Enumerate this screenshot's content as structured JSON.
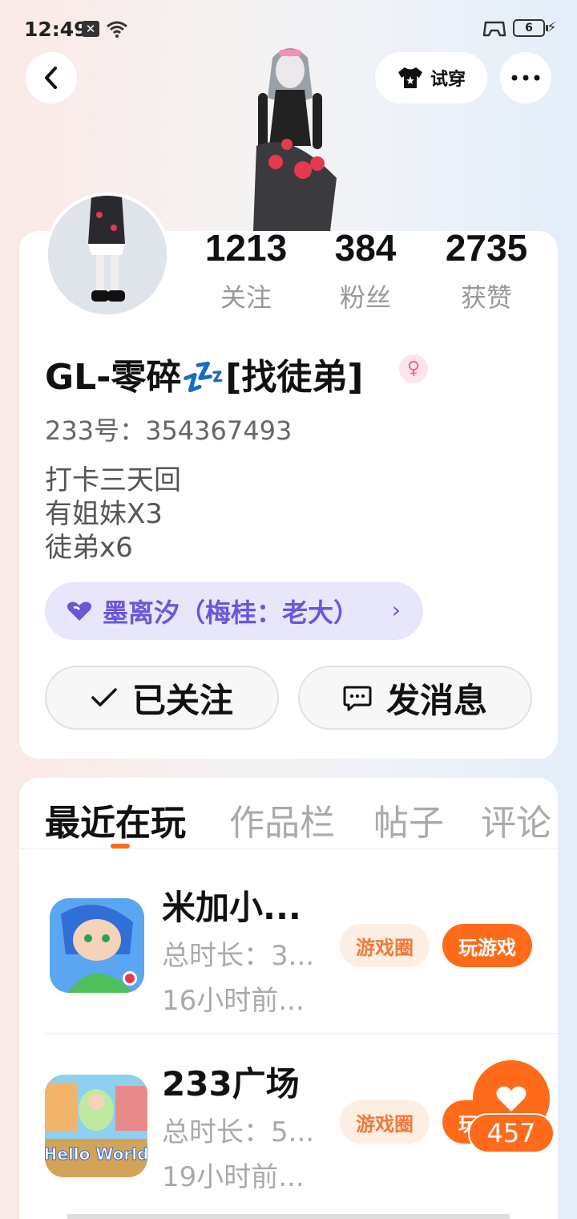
{
  "status_bar": {
    "time": "12:49",
    "battery": "6"
  },
  "header": {
    "try_on_label": "试穿"
  },
  "profile": {
    "stats": [
      {
        "value": "1213",
        "label": "关注"
      },
      {
        "value": "384",
        "label": "粉丝"
      },
      {
        "value": "2735",
        "label": "获赞"
      }
    ],
    "username": "GL-零碎💤[找徒弟]",
    "gender_symbol": "♀",
    "user_id": "233号：354367493",
    "bio": [
      "打卡三天回",
      "有姐妹X3",
      "徒弟x6"
    ],
    "relation": "墨离汐（梅桂：老大）",
    "follow_label": "已关注",
    "message_label": "发消息"
  },
  "tabs": [
    "最近在玩",
    "作品栏",
    "帖子",
    "评论"
  ],
  "games": [
    {
      "name": "米加小...",
      "duration": "总时长：3...",
      "last_played": "16小时前...",
      "circle_label": "游戏圈",
      "play_label": "玩游戏"
    },
    {
      "name": "233广场",
      "duration": "总时长：5...",
      "last_played": "19小时前...",
      "circle_label": "游戏圈",
      "play_label": "玩游戏",
      "icon_text": "Hello World"
    }
  ],
  "like_float": {
    "count": "457"
  },
  "colors": {
    "accent": "#ff6b1a",
    "relation": "#6a57d8",
    "gender": "#f06292"
  }
}
